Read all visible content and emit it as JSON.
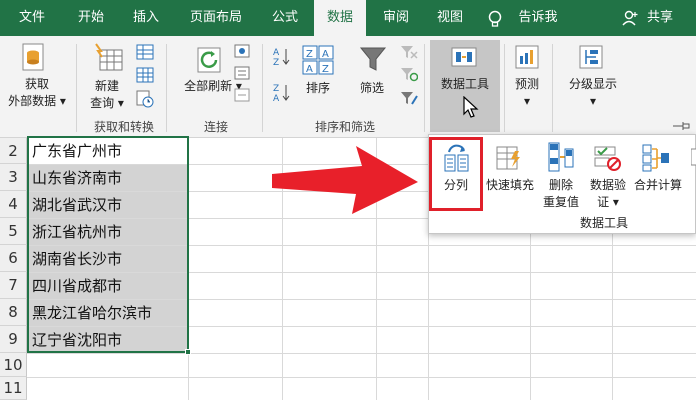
{
  "tabs": [
    "文件",
    "开始",
    "插入",
    "页面布局",
    "公式",
    "数据",
    "审阅",
    "视图",
    "告诉我",
    "共享"
  ],
  "ribbon": {
    "get_external_data_1": "获取",
    "get_external_data_2": "外部数据",
    "new_query_1": "新建",
    "new_query_2": "查询",
    "group_get_transform": "获取和转换",
    "refresh_all": "全部刷新",
    "group_connections": "连接",
    "sort": "排序",
    "filter": "筛选",
    "group_sort_filter": "排序和筛选",
    "data_tools": "数据工具",
    "forecast": "预测",
    "outline": "分级显示"
  },
  "popup": {
    "text_to_columns": "分列",
    "flash_fill": "快速填充",
    "remove_dup_1": "删除",
    "remove_dup_2": "重复值",
    "data_valid_1": "数据验",
    "data_valid_2": "证",
    "consolidate": "合并计算",
    "group_label": "数据工具"
  },
  "rows": [
    "2",
    "3",
    "4",
    "5",
    "6",
    "7",
    "8",
    "9",
    "10",
    "11"
  ],
  "cells": [
    "广东省广州市",
    "山东省济南市",
    "湖北省武汉市",
    "浙江省杭州市",
    "湖南省长沙市",
    "四川省成都市",
    "黑龙江省哈尔滨市",
    "辽宁省沈阳市"
  ],
  "colors": {
    "excel_green": "#217346",
    "arrow_red": "#e8202a",
    "highlight_red": "#e0202a"
  }
}
